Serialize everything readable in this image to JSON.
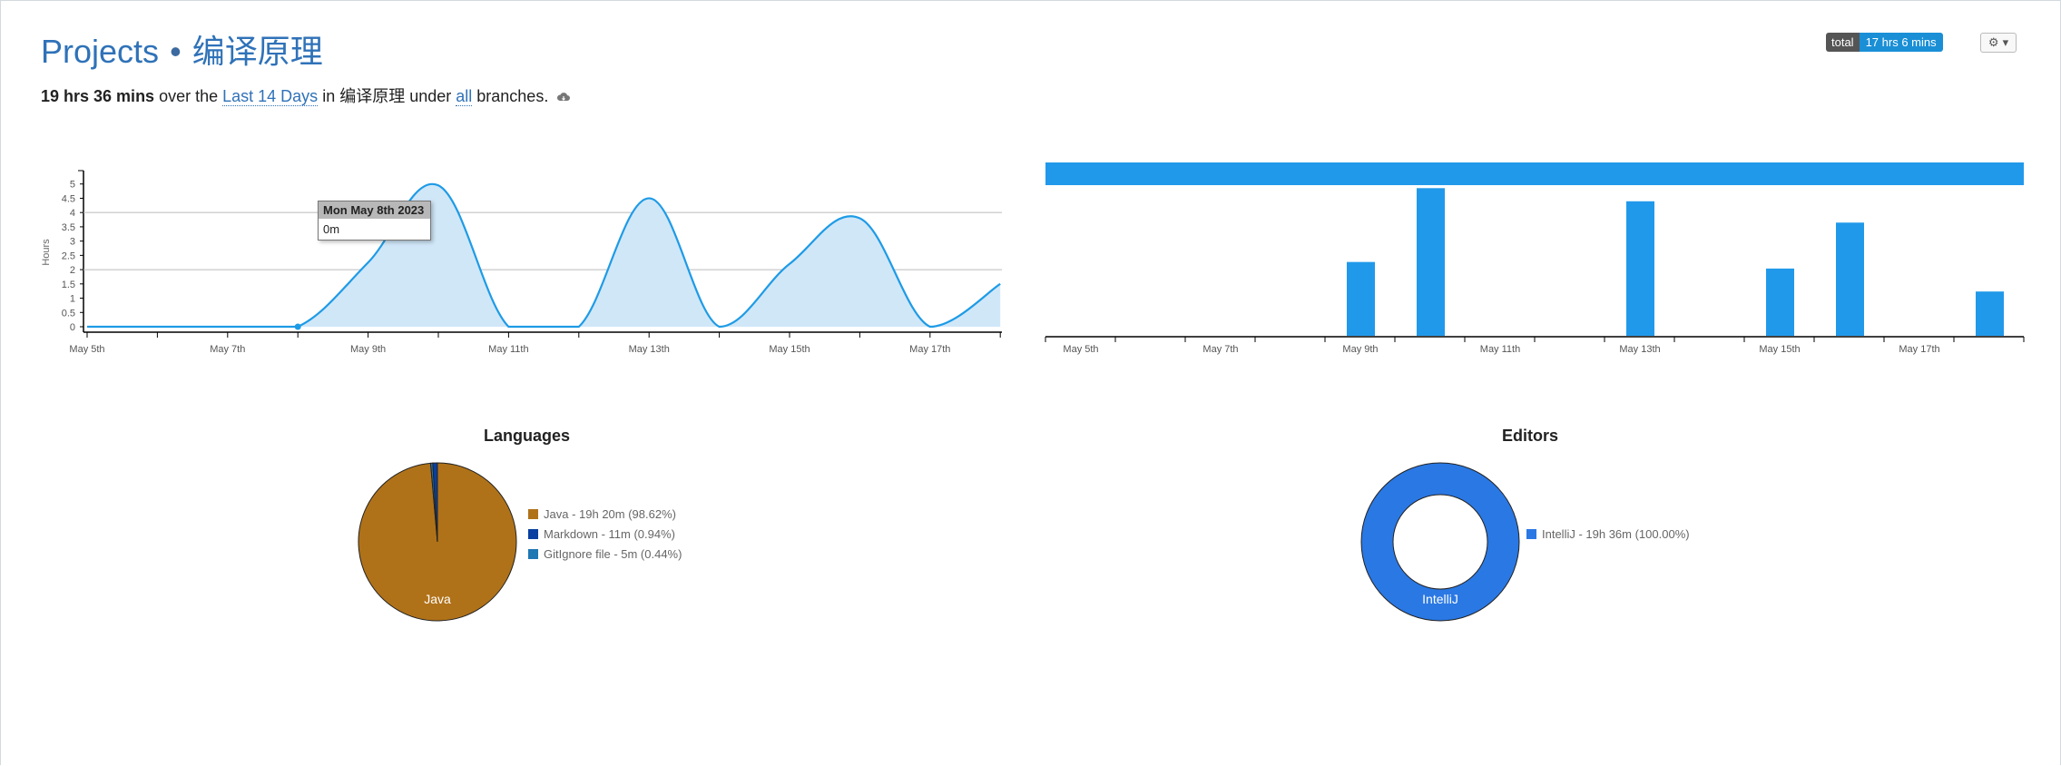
{
  "header": {
    "title_prefix": "Projects",
    "separator": "•",
    "project_name": "编译原理",
    "total_badge_label": "total",
    "total_badge_value": "17 hrs 6 mins"
  },
  "summary": {
    "total": "19 hrs 36 mins",
    "text_over": " over the ",
    "range_link": "Last 14 Days",
    "text_in": " in ",
    "project": "编译原理",
    "text_under": " under ",
    "branch_link": "all",
    "text_branches": " branches."
  },
  "icons": {
    "cloud": "cloud-icon",
    "gear": "gear-icon",
    "caret": "caret-down-icon"
  },
  "colors": {
    "accent": "#2f72b8",
    "line": "#1e9be6",
    "area": "#d0e7f8",
    "bar": "#2199ea",
    "java": "#b07219",
    "markdown": "#083fa1",
    "gitignore": "#1f77b4",
    "intellij": "#2a78e4"
  },
  "tooltip": {
    "title": "Mon May 8th 2023",
    "value": "0m"
  },
  "chart_data": [
    {
      "type": "area",
      "ylabel": "Hours",
      "ylim": [
        0,
        5.5
      ],
      "yticks": [
        "0",
        "0.5",
        "1",
        "1.5",
        "2",
        "2.5",
        "3",
        "3.5",
        "4",
        "4.5",
        "5"
      ],
      "xticks": [
        "May 5th",
        "May 7th",
        "May 9th",
        "May 11th",
        "May 13th",
        "May 15th",
        "May 17th"
      ],
      "grid_lines": [
        2,
        4
      ],
      "x": [
        "May 5th",
        "May 6th",
        "May 7th",
        "May 8th",
        "May 9th",
        "May 10th",
        "May 11th",
        "May 12th",
        "May 13th",
        "May 14th",
        "May 15th",
        "May 16th",
        "May 17th",
        "May 18th"
      ],
      "values": [
        0,
        0,
        0,
        0,
        2.25,
        4.95,
        0,
        0,
        4.5,
        0,
        2.2,
        3.8,
        0,
        1.5
      ]
    },
    {
      "type": "bar",
      "xticks": [
        "May 5th",
        "May 7th",
        "May 9th",
        "May 11th",
        "May 13th",
        "May 15th",
        "May 17th"
      ],
      "x": [
        "May 5th",
        "May 6th",
        "May 7th",
        "May 8th",
        "May 9th",
        "May 10th",
        "May 11th",
        "May 12th",
        "May 13th",
        "May 14th",
        "May 15th",
        "May 16th",
        "May 17th",
        "May 18th"
      ],
      "values": [
        0,
        0,
        0,
        0,
        2.25,
        4.5,
        0,
        0,
        4.1,
        0,
        2.05,
        3.45,
        0,
        1.35
      ]
    },
    {
      "type": "pie",
      "title": "Languages",
      "slices": [
        {
          "label": "Java",
          "legend": "Java - 19h 20m (98.62%)",
          "value": 98.62
        },
        {
          "label": "Markdown",
          "legend": "Markdown - 11m (0.94%)",
          "value": 0.94
        },
        {
          "label": "GitIgnore file",
          "legend": "GitIgnore file - 5m (0.44%)",
          "value": 0.44
        }
      ],
      "inner_label": "Java"
    },
    {
      "type": "pie",
      "title": "Editors",
      "donut": true,
      "slices": [
        {
          "label": "IntelliJ",
          "legend": "IntelliJ - 19h 36m (100.00%)",
          "value": 100
        }
      ],
      "inner_label": "IntelliJ"
    }
  ]
}
